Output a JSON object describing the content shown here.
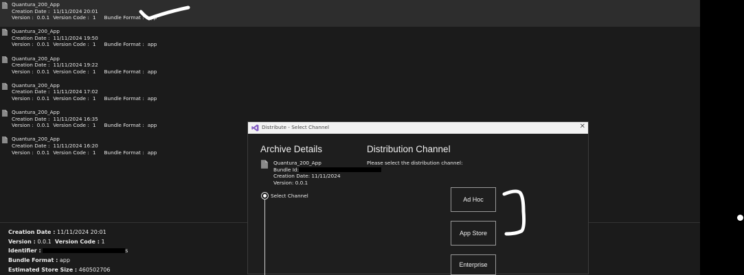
{
  "archives": [
    {
      "name": "Quantura_200_App",
      "creation_label": "Creation Date :",
      "creation_date": "11/11/2024 20:01",
      "version_label": "Version :",
      "version": "0.0.1",
      "version_code_label": "Version Code :",
      "version_code": "1",
      "bundle_format_label": "Bundle Format :",
      "bundle_format": "app"
    },
    {
      "name": "Quantura_200_App",
      "creation_label": "Creation Date :",
      "creation_date": "11/11/2024 19:50",
      "version_label": "Version :",
      "version": "0.0.1",
      "version_code_label": "Version Code :",
      "version_code": "1",
      "bundle_format_label": "Bundle Format :",
      "bundle_format": "app"
    },
    {
      "name": "Quantura_200_App",
      "creation_label": "Creation Date :",
      "creation_date": "11/11/2024 19:22",
      "version_label": "Version :",
      "version": "0.0.1",
      "version_code_label": "Version Code :",
      "version_code": "1",
      "bundle_format_label": "Bundle Format :",
      "bundle_format": "app"
    },
    {
      "name": "Quantura_200_App",
      "creation_label": "Creation Date :",
      "creation_date": "11/11/2024 17:02",
      "version_label": "Version :",
      "version": "0.0.1",
      "version_code_label": "Version Code :",
      "version_code": "1",
      "bundle_format_label": "Bundle Format :",
      "bundle_format": "app"
    },
    {
      "name": "Quantura_200_App",
      "creation_label": "Creation Date :",
      "creation_date": "11/11/2024 16:35",
      "version_label": "Version :",
      "version": "0.0.1",
      "version_code_label": "Version Code :",
      "version_code": "1",
      "bundle_format_label": "Bundle Format :",
      "bundle_format": "app"
    },
    {
      "name": "Quantura_200_App",
      "creation_label": "Creation Date :",
      "creation_date": "11/11/2024 16:20",
      "version_label": "Version :",
      "version": "0.0.1",
      "version_code_label": "Version Code :",
      "version_code": "1",
      "bundle_format_label": "Bundle Format :",
      "bundle_format": "app"
    }
  ],
  "details": {
    "creation_label": "Creation Date :",
    "creation_date": "11/11/2024 20:01",
    "version_label": "Version :",
    "version": "0.0.1",
    "version_code_label": "Version Code :",
    "version_code": "1",
    "identifier_label": "Identifier :",
    "identifier_tail": "s",
    "bundle_format_label": "Bundle Format :",
    "bundle_format": "app",
    "store_size_label": "Estimated Store Size :",
    "store_size": "460502706"
  },
  "dialog": {
    "title": "Distribute - Select Channel",
    "close_glyph": "✕",
    "archive_heading": "Archive Details",
    "archive_name": "Quantura_200_App",
    "bundle_id_label": "Bundle Id:",
    "creation_date": "Creation Date: 11/11/2024",
    "version": "Version: 0.0.1",
    "step_label": "Select Channel",
    "channel_heading": "Distribution Channel",
    "channel_prompt": "Please select the distribution channel:",
    "channels": [
      "Ad Hoc",
      "App Store",
      "Enterprise"
    ]
  },
  "icons": {
    "file": "archive-file-icon",
    "vs": "visual-studio-icon"
  },
  "colors": {
    "pane_bg": "#1b1b1b",
    "selected_bg": "#2d2d2d",
    "dialog_bg": "#1e1e1e",
    "titlebar_bg": "#f3f3f3",
    "vs_purple": "#8661c5"
  }
}
